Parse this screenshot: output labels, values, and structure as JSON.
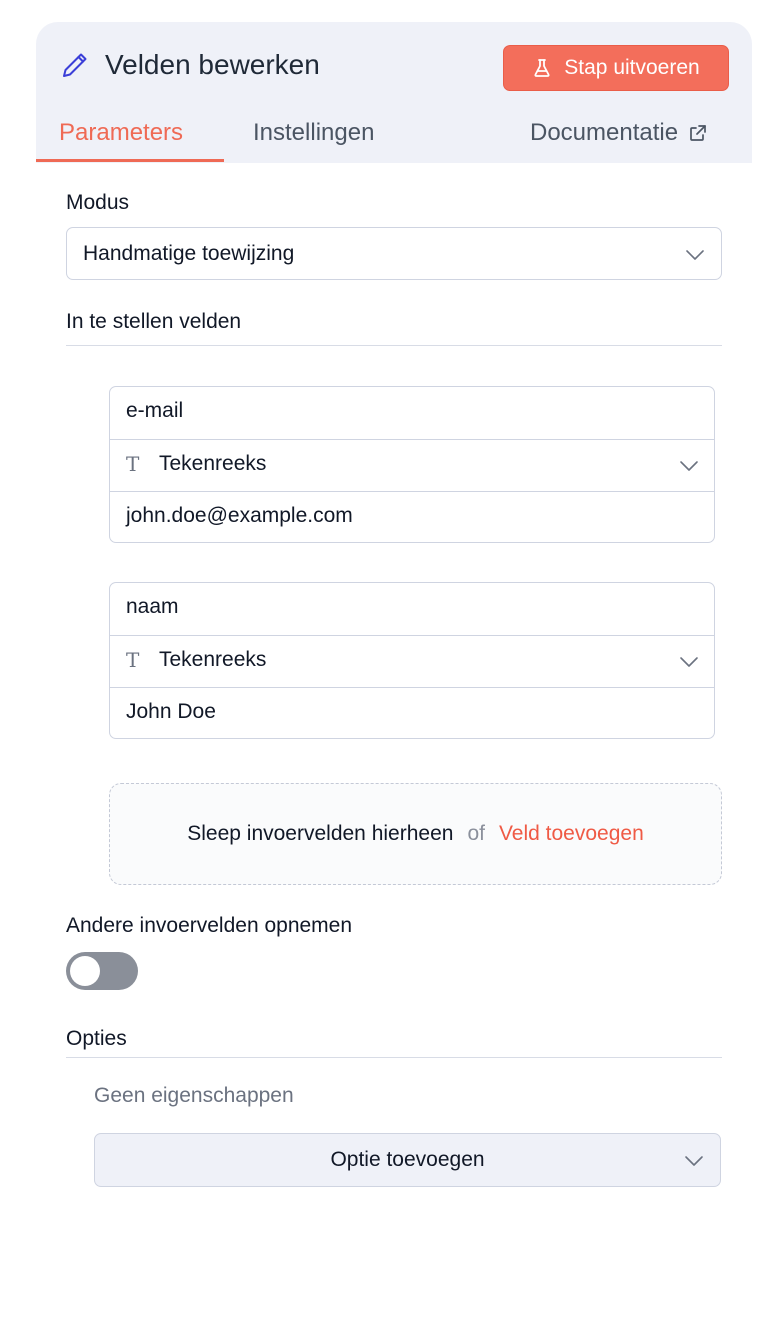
{
  "header": {
    "title": "Velden bewerken",
    "run_button": "Stap uitvoeren",
    "tabs": [
      {
        "label": "Parameters",
        "active": true
      },
      {
        "label": "Instellingen",
        "active": false
      },
      {
        "label": "Documentatie",
        "active": false
      }
    ]
  },
  "mode": {
    "label": "Modus",
    "value": "Handmatige toewijzing"
  },
  "fields_section": {
    "label": "In te stellen velden",
    "fields": [
      {
        "name": "e-mail",
        "type": "Tekenreeks",
        "value": "john.doe@example.com"
      },
      {
        "name": "naam",
        "type": "Tekenreeks",
        "value": "John Doe"
      }
    ],
    "dropzone": {
      "text": "Sleep invoervelden hierheen",
      "or": "of",
      "link": "Veld toevoegen"
    }
  },
  "include_other": {
    "label": "Andere invoervelden opnemen",
    "enabled": false
  },
  "options": {
    "label": "Opties",
    "empty_text": "Geen eigenschappen",
    "add_button": "Optie toevoegen"
  },
  "colors": {
    "accent": "#f36e5b",
    "header_bg": "#eff1f8",
    "toggle_off": "#8a8f99"
  },
  "icons": {
    "title": "pencil-icon",
    "run": "flask-icon",
    "docs": "external-link-icon",
    "type": "text-type-icon",
    "dropdown": "chevron-down-icon"
  }
}
